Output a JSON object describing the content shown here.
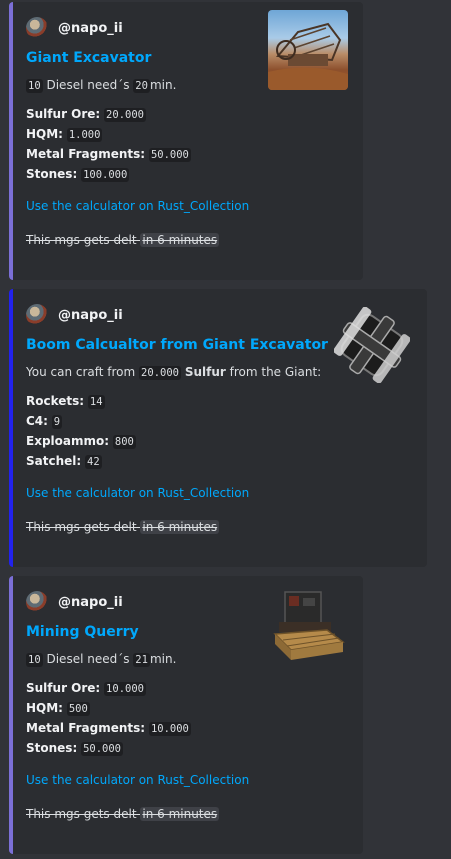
{
  "embeds": [
    {
      "author": "@napo_ii",
      "title": "Giant Excavator",
      "desc": {
        "fuel_amount": "10",
        "fuel_text": "Diesel need´s",
        "minutes": "20",
        "min_label": "min."
      },
      "fields": [
        {
          "label": "Sulfur Ore:",
          "value": "20.000"
        },
        {
          "label": "HQM:",
          "value": "1.000"
        },
        {
          "label": "Metal Fragments:",
          "value": "50.000"
        },
        {
          "label": "Stones:",
          "value": "100.000"
        }
      ],
      "link": "Use the calculator on Rust_Collection",
      "footer": "This mgs gets delt",
      "timestamp": "in 6 minutes",
      "thumbnail": "giant-excavator-image",
      "accent": "#7b6fd6"
    },
    {
      "author": "@napo_ii",
      "title": "Boom Calcualtor from Giant Excavator",
      "desc": {
        "prefix": "You can craft from",
        "amount": "20.000",
        "resource": "Sulfur",
        "suffix": "from the Giant:"
      },
      "fields": [
        {
          "label": "Rockets:",
          "value": "14"
        },
        {
          "label": "C4:",
          "value": "9"
        },
        {
          "label": "Exploammo:",
          "value": "800"
        },
        {
          "label": "Satchel:",
          "value": "42"
        }
      ],
      "link": "Use the calculator on Rust_Collection",
      "footer": "This mgs gets delt",
      "timestamp": "in 6 minutes",
      "thumbnail": "c4-explosive-image",
      "accent": "#2222ee"
    },
    {
      "author": "@napo_ii",
      "title": "Mining Querry",
      "desc": {
        "fuel_amount": "10",
        "fuel_text": "Diesel need´s",
        "minutes": "21",
        "min_label": "min."
      },
      "fields": [
        {
          "label": "Sulfur Ore:",
          "value": "10.000"
        },
        {
          "label": "HQM:",
          "value": "500"
        },
        {
          "label": "Metal Fragments:",
          "value": "10.000"
        },
        {
          "label": "Stones:",
          "value": "50.000"
        }
      ],
      "link": "Use the calculator on Rust_Collection",
      "footer": "This mgs gets delt",
      "timestamp": "in 6 minutes",
      "thumbnail": "mining-quarry-image",
      "accent": "#7b6fd6"
    }
  ]
}
